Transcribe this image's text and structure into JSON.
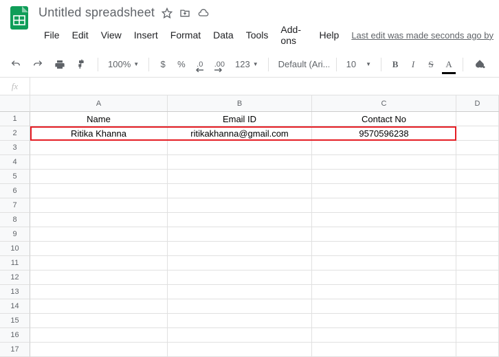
{
  "doc": {
    "title": "Untitled spreadsheet"
  },
  "menu": {
    "file": "File",
    "edit": "Edit",
    "view": "View",
    "insert": "Insert",
    "format": "Format",
    "data": "Data",
    "tools": "Tools",
    "addons": "Add-ons",
    "help": "Help",
    "last_edit": "Last edit was made seconds ago by"
  },
  "toolbar": {
    "zoom": "100%",
    "dollar": "$",
    "percent": "%",
    "dec_dec": ".0",
    "inc_dec": ".00",
    "num_format": "123",
    "font": "Default (Ari...",
    "size": "10",
    "bold": "B",
    "italic": "I",
    "strike": "S",
    "textcolor": "A"
  },
  "fx": {
    "label": "fx",
    "value": ""
  },
  "columns": [
    "A",
    "B",
    "C",
    "D"
  ],
  "row_numbers": [
    "1",
    "2",
    "3",
    "4",
    "5",
    "6",
    "7",
    "8",
    "9",
    "10",
    "11",
    "12",
    "13",
    "14",
    "15",
    "16",
    "17"
  ],
  "sheet": {
    "r1": {
      "a": "Name",
      "b": "Email ID",
      "c": "Contact No"
    },
    "r2": {
      "a": "Ritika Khanna",
      "b": "ritikakhanna@gmail.com",
      "c": "9570596238"
    }
  }
}
